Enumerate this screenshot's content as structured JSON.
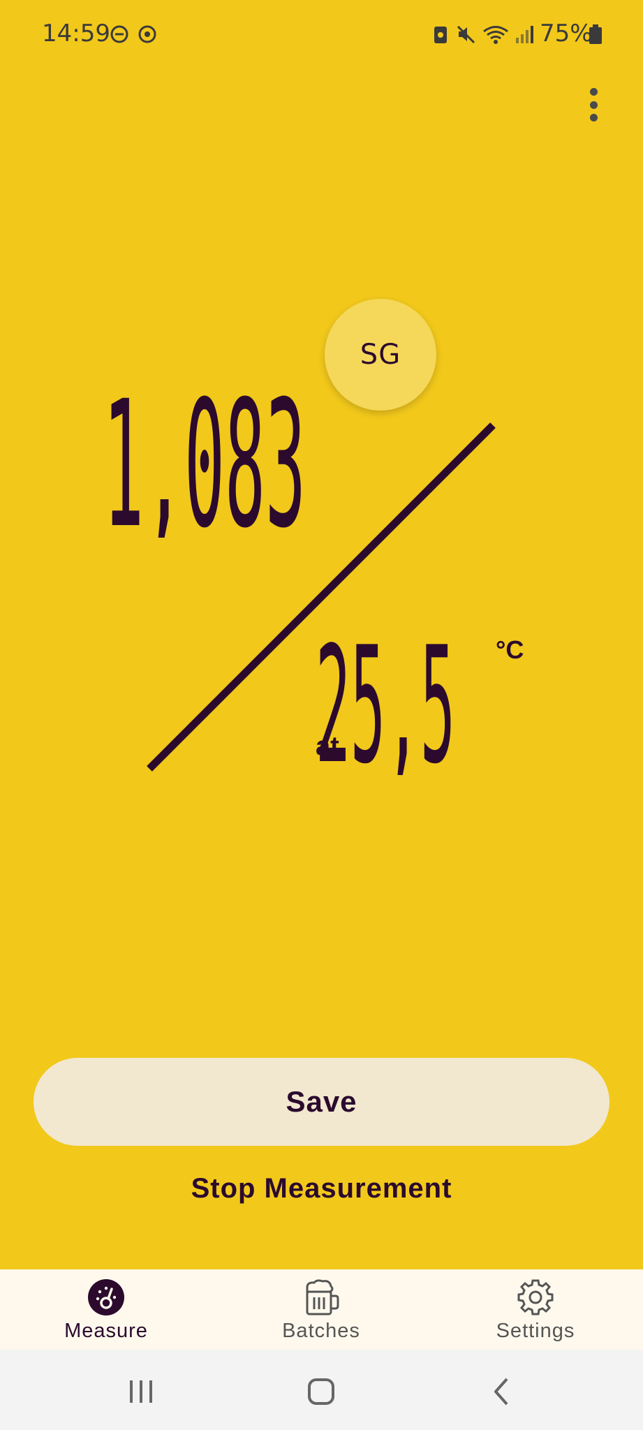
{
  "status_bar": {
    "time": "14:59",
    "battery_percent": "75%",
    "icons": [
      "do-not-disturb-icon",
      "sync-icon",
      "battery-saver-icon",
      "mute-icon",
      "wifi-icon",
      "signal-icon",
      "battery-icon"
    ]
  },
  "toolbar": {
    "menu_icon": "more-vert-icon"
  },
  "measurement": {
    "unit_toggle": "SG",
    "gravity_value": "1,083",
    "temperature_prefix": "at",
    "temperature_value": "25,5",
    "temperature_unit": "°C"
  },
  "actions": {
    "save_label": "Save",
    "stop_label": "Stop Measurement"
  },
  "bottom_nav": {
    "items": [
      {
        "label": "Measure",
        "icon": "hydrometer-gauge-icon",
        "active": true
      },
      {
        "label": "Batches",
        "icon": "beer-mug-icon",
        "active": false
      },
      {
        "label": "Settings",
        "icon": "gear-icon",
        "active": false
      }
    ]
  },
  "colors": {
    "background": "#F2C81B",
    "primary_dark": "#2B0A2E",
    "save_button": "#F1E8CF",
    "nav_background": "#FFF9ED"
  }
}
